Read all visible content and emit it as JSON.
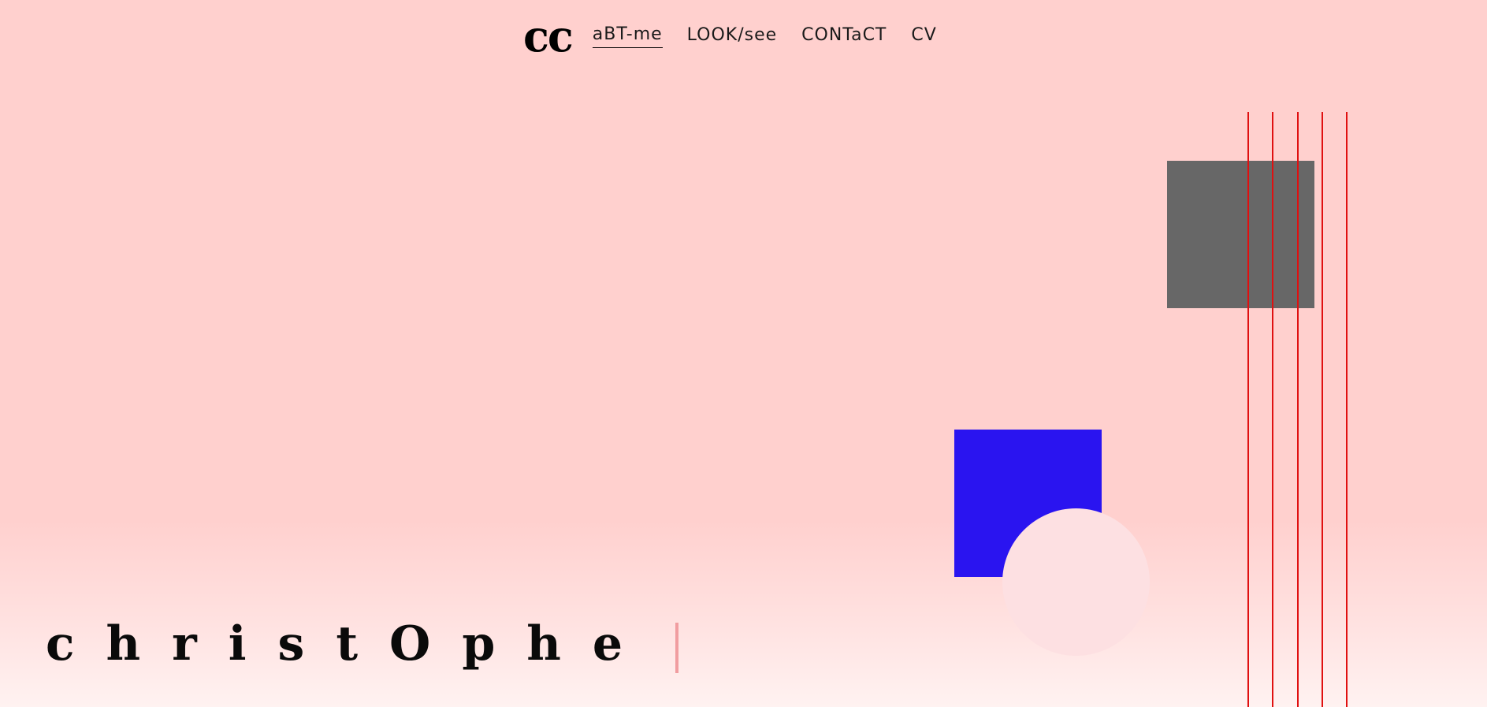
{
  "nav": {
    "logo": "cc",
    "links": [
      {
        "label": "aBT-me",
        "active": true
      },
      {
        "label": "LOOK/see",
        "active": false
      },
      {
        "label": "CONTaCT",
        "active": false
      },
      {
        "label": "CV",
        "active": false
      }
    ]
  },
  "hero": {
    "name": "christOphe"
  },
  "colors": {
    "background": "#ffd0ce",
    "gray_square": "#676767",
    "red_lines": "#e01010",
    "blue_square": "#2a14f0",
    "pink_circle": "#fde0e2",
    "cursor": "#f19da0"
  }
}
